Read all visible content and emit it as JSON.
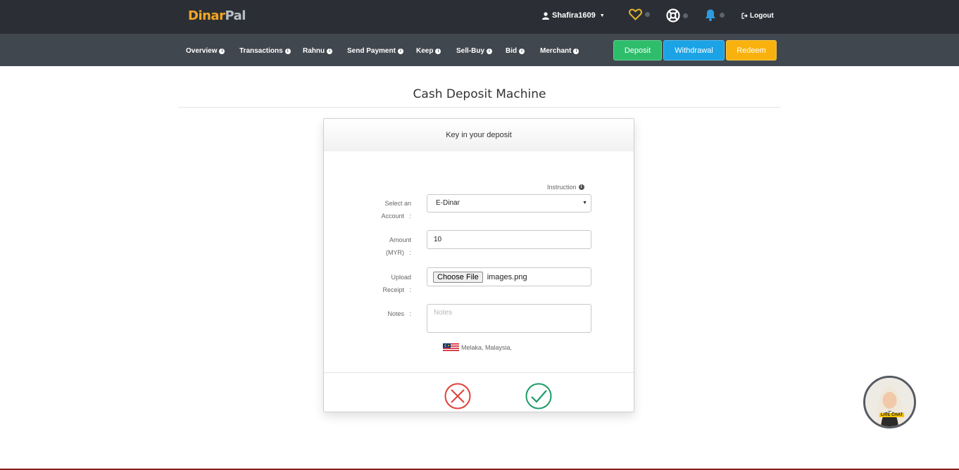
{
  "brand": {
    "part1": "Dinar",
    "part2": "Pal"
  },
  "topbar": {
    "username": "Shafira1609",
    "logout_label": "Logout",
    "icons": [
      "heart-icon",
      "lifebuoy-icon",
      "bell-icon"
    ]
  },
  "nav": {
    "items": [
      {
        "label": "Overview"
      },
      {
        "label": "Transactions"
      },
      {
        "label": "Rahnu"
      },
      {
        "label": "Send Payment"
      },
      {
        "label": "Keep"
      },
      {
        "label": "Sell-Buy"
      },
      {
        "label": "Bid"
      },
      {
        "label": "Merchant"
      }
    ],
    "deposit_label": "Deposit",
    "withdrawal_label": "Withdrawal",
    "redeem_label": "Redeem"
  },
  "page": {
    "title": "Cash Deposit Machine"
  },
  "form": {
    "header": "Key in your deposit",
    "instruction_label": "Instruction",
    "account_label_1": "Select an",
    "account_label_2": "Account",
    "account_value": "E-Dinar",
    "amount_label_1": "Amount",
    "amount_label_2": "(MYR)",
    "amount_value": "10",
    "upload_label_1": "Upload",
    "upload_label_2": "Receipt",
    "choose_file_label": "Choose File",
    "file_name": "images.png",
    "notes_label": "Notes",
    "notes_placeholder": "Notes",
    "location": "Melaka, Malaysia,",
    "colon": ":"
  },
  "livechat": {
    "tag": "LIVE CHAT"
  },
  "colors": {
    "topbar": "#2b2f35",
    "navbar": "#41474f",
    "deposit": "#2ebd6b",
    "withdrawal": "#1ca3e6",
    "redeem": "#f9b20d",
    "cancel": "#e0403b",
    "confirm": "#1b9a66"
  }
}
